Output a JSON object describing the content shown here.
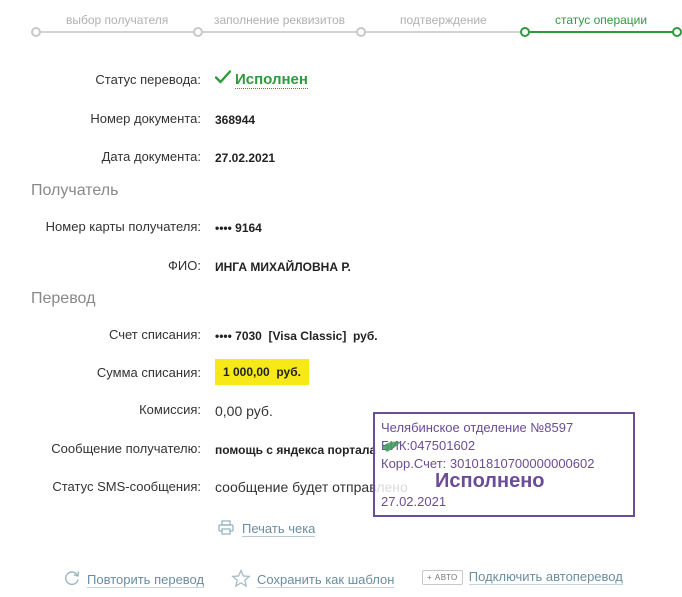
{
  "steps": [
    {
      "label": "выбор получателя",
      "active": false
    },
    {
      "label": "заполнение реквизитов",
      "active": false
    },
    {
      "label": "подтверждение",
      "active": false
    },
    {
      "label": "статус операции",
      "active": true
    }
  ],
  "transfer_status": {
    "label": "Статус перевода:",
    "value": "Исполнен"
  },
  "document_number": {
    "label": "Номер документа:",
    "value": "368944"
  },
  "document_date": {
    "label": "Дата документа:",
    "value": "27.02.2021"
  },
  "recipient_section": "Получатель",
  "card_number": {
    "label": "Номер карты получателя:",
    "value": "•••• 9164"
  },
  "full_name": {
    "label": "ФИО:",
    "value": "ИНГА МИХАЙЛОВНА Р."
  },
  "transfer_section": "Перевод",
  "debit_account": {
    "label": "Счет списания:",
    "value": "•••• 7030  [Visa Classic]  руб."
  },
  "debit_amount": {
    "label": "Сумма списания:",
    "value": "1 000,00  руб."
  },
  "commission": {
    "label": "Комиссия:",
    "value": "0,00 руб."
  },
  "message": {
    "label": "Сообщение получателю:",
    "value": "помощь с яндекса портала"
  },
  "sms_status": {
    "label": "Статус SMS-сообщения:",
    "value": "сообщение будет отправлено"
  },
  "print_receipt": "Печать чека",
  "actions": {
    "repeat": "Повторить перевод",
    "save_template": "Сохранить как шаблон",
    "auto_badge": "+ АВТО",
    "auto_transfer": "Подключить автоперевод"
  },
  "stamp": {
    "branch": "Челябинское отделение №8597",
    "bik": "БИК:047501602",
    "corr_account": "Корр.Счет: 30101810700000000602",
    "status": "Исполнено",
    "date": "27.02.2021"
  },
  "colors": {
    "accent_green": "#2e9a3c",
    "amount_highlight": "#f7e818",
    "stamp_purple": "#6b4c96",
    "link_blue": "#6a8da0"
  }
}
